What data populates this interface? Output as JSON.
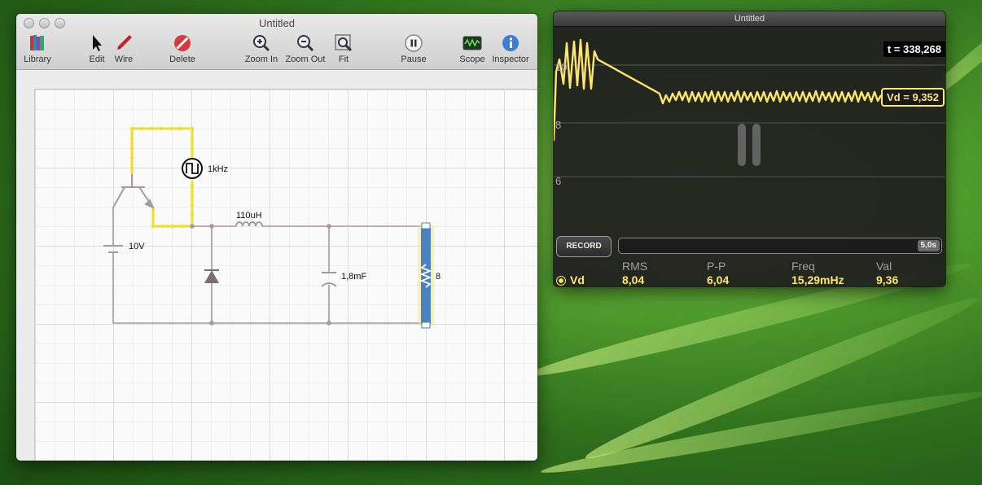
{
  "editor": {
    "title": "Untitled",
    "toolbar": {
      "library": "Library",
      "edit": "Edit",
      "wire": "Wire",
      "delete": "Delete",
      "zoom_in": "Zoom In",
      "zoom_out": "Zoom Out",
      "fit": "Fit",
      "pause": "Pause",
      "scope": "Scope",
      "inspector": "Inspector"
    },
    "circuit": {
      "source_label": "1kHz",
      "battery_label": "10V",
      "inductor_label": "110uH",
      "capacitor_label": "1,8mF",
      "resistor_label": "8"
    }
  },
  "scope": {
    "title": "Untitled",
    "time_readout": "t = 338,268",
    "probe_readout": "Vd = 9,352",
    "y_ticks": [
      "10",
      "8",
      "6"
    ],
    "record_label": "RECORD",
    "duration": "5,0s",
    "stats": {
      "headers": [
        "RMS",
        "P-P",
        "Freq",
        "Val"
      ],
      "probe_name": "Vd",
      "values": [
        "8,04",
        "6,04",
        "15,29mHz",
        "9,36"
      ]
    },
    "trace_color": "#ffe56a"
  }
}
